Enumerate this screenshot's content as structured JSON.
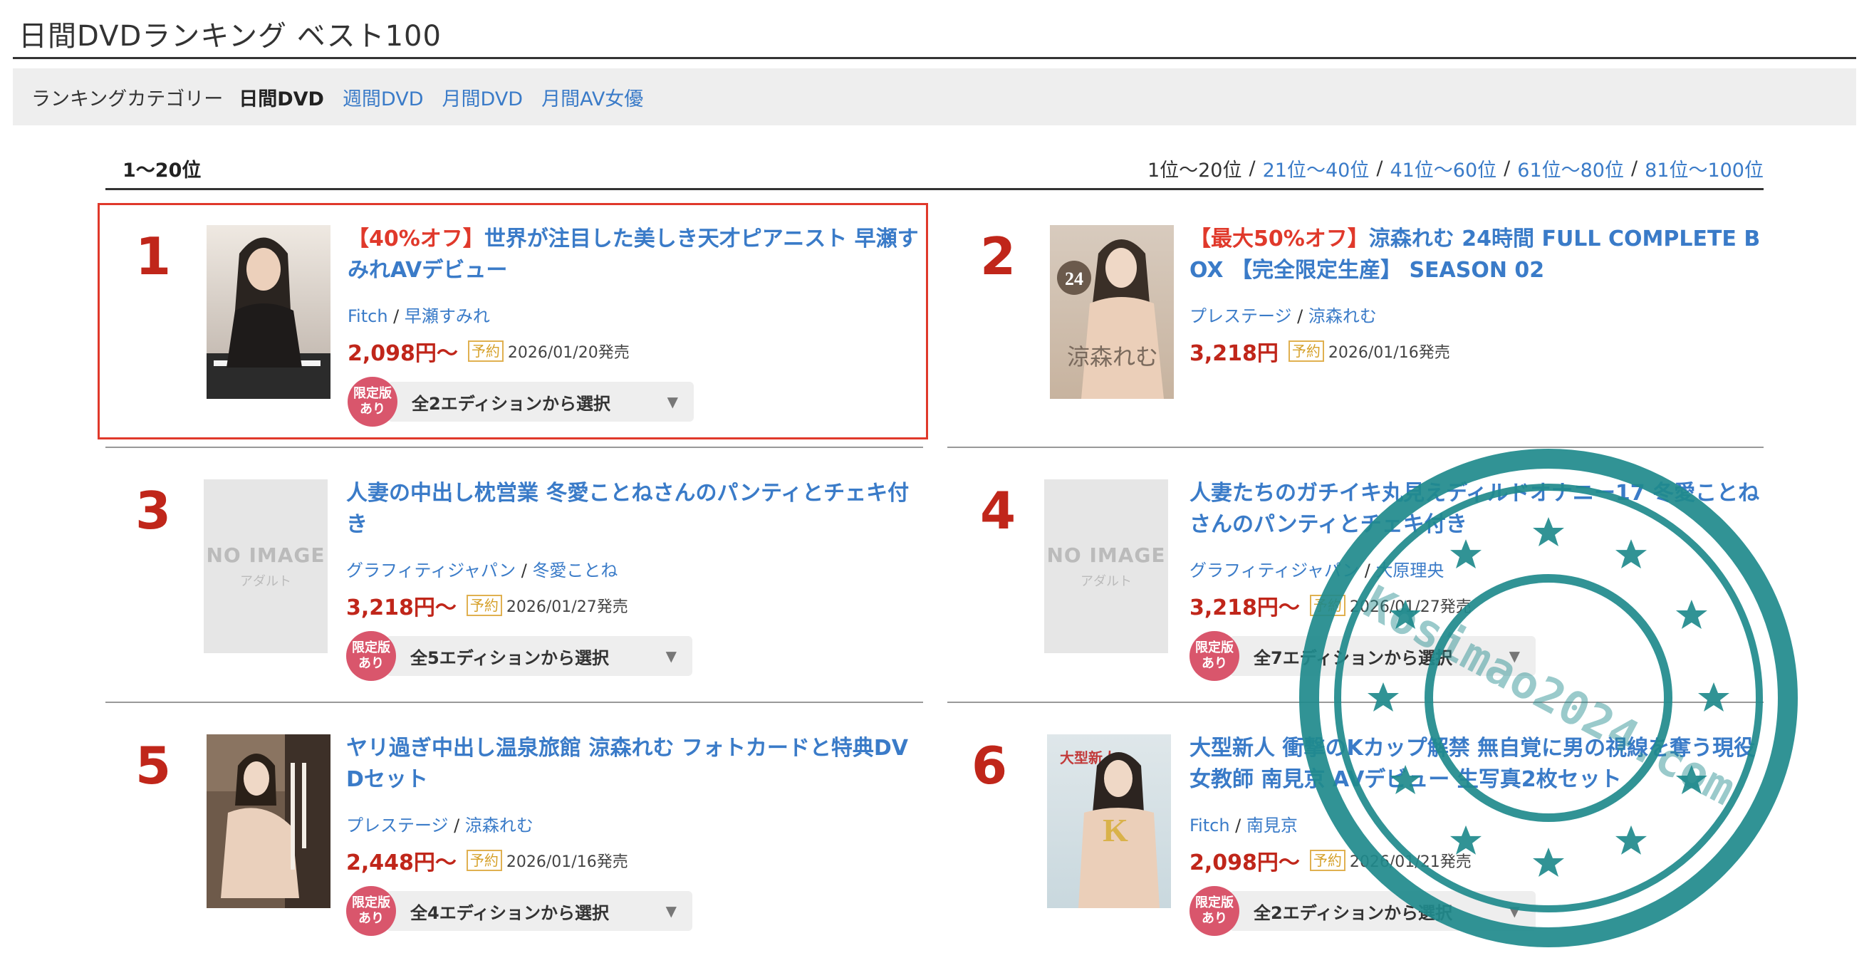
{
  "page_title": "日間DVDランキング ベスト100",
  "categories": {
    "label": "ランキングカテゴリー",
    "items": [
      {
        "label": "日間DVD",
        "active": true
      },
      {
        "label": "週間DVD",
        "active": false
      },
      {
        "label": "月間DVD",
        "active": false
      },
      {
        "label": "月間AV女優",
        "active": false
      }
    ]
  },
  "range": {
    "current": "1〜20位",
    "pager": [
      "1位〜20位",
      "21位〜40位",
      "41位〜60位",
      "61位〜80位",
      "81位〜100位"
    ],
    "separator": "/"
  },
  "entries": [
    {
      "rank": "1",
      "promo": "【40%オフ】",
      "title_l1": "世界が注目した美しき天才ピアニスト 早瀬す",
      "title_l2": "みれAVデビュー",
      "maker": "Fitch",
      "actress": "早瀬すみれ",
      "price": "2,098円〜",
      "badge": "予約",
      "release": "2026/01/20発売",
      "limited_l1": "限定版",
      "limited_l2": "あり",
      "edition": "全2エディションから選択"
    },
    {
      "rank": "2",
      "promo": "【最大50%オフ】",
      "title_l1": "涼森れむ 24時間 FULL COMPLETE B",
      "title_l2": "OX 【完全限定生産】 SEASON 02",
      "maker": "プレステージ",
      "actress": "涼森れむ",
      "price": "3,218円",
      "badge": "予約",
      "release": "2026/01/16発売",
      "image_text": "涼森れむ",
      "image_badge": "24"
    },
    {
      "rank": "3",
      "title_l1": "人妻の中出し枕営業 冬愛ことねさんのパンティとチェキ付",
      "title_l2": "き",
      "maker": "グラフィティジャパン",
      "actress": "冬愛ことね",
      "price": "3,218円〜",
      "badge": "予約",
      "release": "2026/01/27発売",
      "limited_l1": "限定版",
      "limited_l2": "あり",
      "edition": "全5エディションから選択",
      "noimage_l1": "NO IMAGE",
      "noimage_l2": "アダルト"
    },
    {
      "rank": "4",
      "title_l1": "人妻たちのガチイキ丸見えディルドオナニー17 冬愛ことね",
      "title_l2": "さんのパンティとチェキ付き",
      "maker": "グラフィティジャパン",
      "actress": "大原理央",
      "price": "3,218円〜",
      "badge": "予約",
      "release": "2026/01/27発売",
      "limited_l1": "限定版",
      "limited_l2": "あり",
      "edition": "全7エディションから選択",
      "noimage_l1": "NO IMAGE",
      "noimage_l2": "アダルト"
    },
    {
      "rank": "5",
      "title_l1": "ヤリ過ぎ中出し温泉旅館 涼森れむ フォトカードと特典DV",
      "title_l2": "Dセット",
      "maker": "プレステージ",
      "actress": "涼森れむ",
      "price": "2,448円〜",
      "badge": "予約",
      "release": "2026/01/16発売",
      "limited_l1": "限定版",
      "limited_l2": "あり",
      "edition": "全4エディションから選択"
    },
    {
      "rank": "6",
      "title_l1": "大型新人 衝撃のKカップ解禁 無自覚に男の視線を奪う現役",
      "title_l2": "女教師 南見京 AVデビュー 生写真2枚セット",
      "maker": "Fitch",
      "actress": "南見京",
      "price": "2,098円〜",
      "badge": "予約",
      "release": "2026/01/21発売",
      "limited_l1": "限定版",
      "limited_l2": "あり",
      "edition": "全2エディションから選択",
      "image_text": "K",
      "image_badge": "大型新人"
    }
  ],
  "stamp": {
    "text": "Kosimao2024.com",
    "color": "#1f8a8c"
  },
  "colors": {
    "link": "#3a7bc8",
    "price": "#c0261a",
    "promo": "#e0392b",
    "limited": "#d9566c"
  }
}
